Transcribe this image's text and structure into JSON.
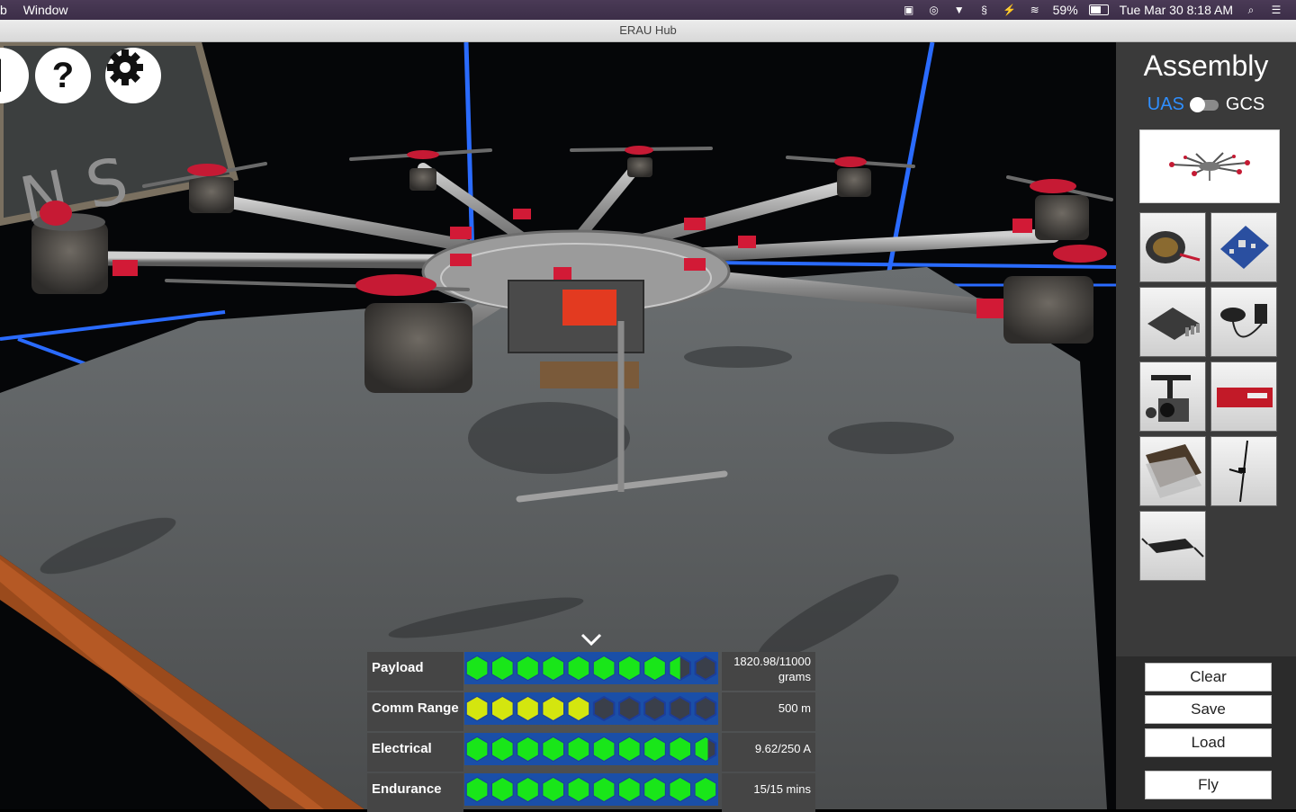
{
  "menubar": {
    "left_items": [
      "b",
      "Window"
    ],
    "battery_text": "59%",
    "datetime": "Tue Mar 30  8:18 AM"
  },
  "window": {
    "title": "ERAU Hub"
  },
  "top_buttons": {
    "help_label": "?"
  },
  "sidebar": {
    "title": "Assembly",
    "toggle_left": "UAS",
    "toggle_right": "GCS",
    "toggle_selected": "UAS",
    "accent_color": "#2f8fff"
  },
  "stats": {
    "rows": [
      {
        "label": "Payload",
        "value": "1820.98/11000 grams",
        "filled": 8.5,
        "total": 10,
        "color": "#19e619"
      },
      {
        "label": "Comm Range",
        "value": "500 m",
        "filled": 5,
        "total": 10,
        "color": "#d4e60f"
      },
      {
        "label": "Electrical",
        "value": "9.62/250 A",
        "filled": 9.6,
        "total": 10,
        "color": "#19e619"
      },
      {
        "label": "Endurance",
        "value": "15/15 mins",
        "filled": 10,
        "total": 10,
        "color": "#19e619"
      }
    ]
  },
  "actions": {
    "clear": "Clear",
    "save": "Save",
    "load": "Load",
    "fly": "Fly"
  }
}
